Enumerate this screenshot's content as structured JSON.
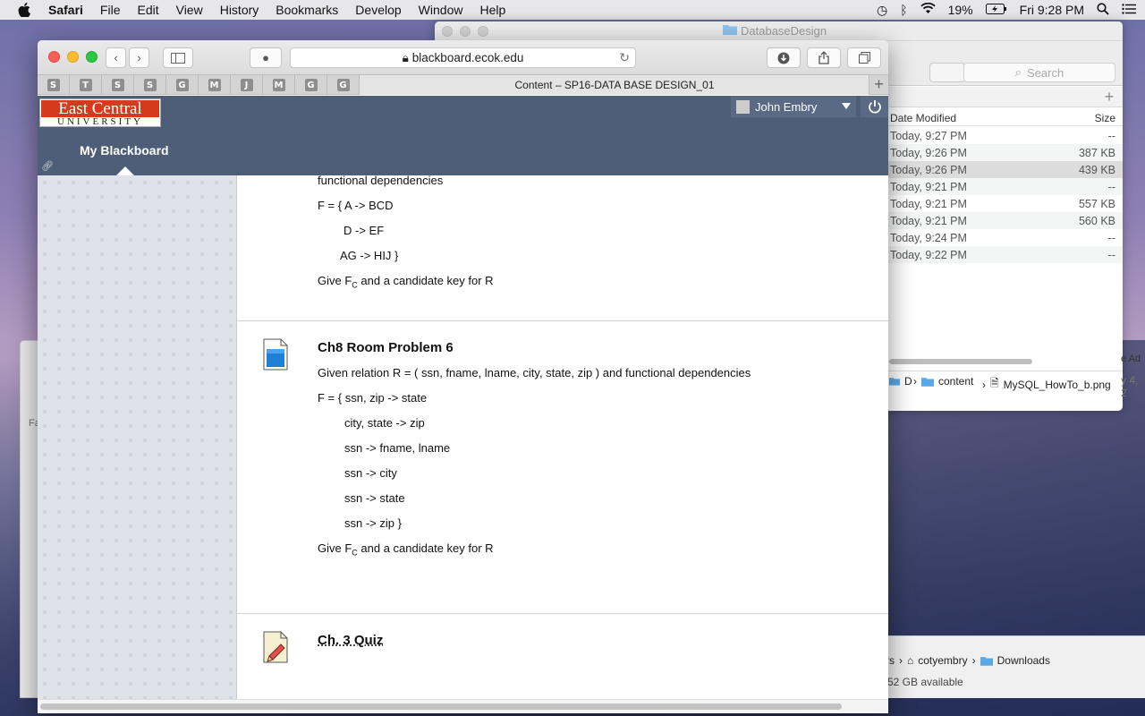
{
  "menubar": {
    "app": "Safari",
    "items": [
      "File",
      "Edit",
      "View",
      "History",
      "Bookmarks",
      "Develop",
      "Window",
      "Help"
    ],
    "battery": "19%",
    "clock": "Fri 9:28 PM"
  },
  "finder": {
    "title": "DatabaseDesign",
    "search_placeholder": "Search",
    "col_date": "Date Modified",
    "col_size": "Size",
    "rows": [
      {
        "date": "Today, 9:27 PM",
        "size": "--"
      },
      {
        "date": "Today, 9:26 PM",
        "size": "387 KB"
      },
      {
        "date": "Today, 9:26 PM",
        "size": "439 KB"
      },
      {
        "date": "Today, 9:21 PM",
        "size": "--"
      },
      {
        "date": "Today, 9:21 PM",
        "size": "557 KB"
      },
      {
        "date": "Today, 9:21 PM",
        "size": "560 KB"
      },
      {
        "date": "Today, 9:24 PM",
        "size": "--"
      },
      {
        "date": "Today, 9:22 PM",
        "size": "--"
      }
    ],
    "path": {
      "p1": "D",
      "p2": "content",
      "p3": "MySQL_HowTo_b.png"
    },
    "side_text_1": "e Ad",
    "side_text_2": "y 4, 2"
  },
  "finder2": {
    "path": {
      "p0": "rs",
      "p1": "cotyembry",
      "p2": "Downloads"
    },
    "available": "52 GB available"
  },
  "leftwin": {
    "label": "Fa"
  },
  "safari": {
    "url": "blackboard.ecok.edu",
    "pinned_tabs": [
      "S",
      "T",
      "S",
      "S",
      "G",
      "M",
      "J",
      "M",
      "G",
      "G"
    ],
    "active_tab_title": "Content – SP16-DATA BASE DESIGN_01"
  },
  "blackboard": {
    "logo_top": "East Central",
    "logo_bottom": "UNIVERSITY",
    "user_name": "John Embry",
    "my_blackboard": "My Blackboard",
    "item1": {
      "line0": "functional dependencies",
      "f1": "F = { A -> BCD",
      "f2": "D -> EF",
      "f3": "AG -> HIJ }",
      "give_pre": "Give F",
      "give_sub": "C",
      "give_post": " and a candidate key for R"
    },
    "item2": {
      "title": "Ch8 Room Problem 6",
      "given": "Given relation R = ( ssn, fname, lname, city, state, zip ) and functional dependencies",
      "f1": "F = { ssn, zip -> state",
      "f2": "city, state -> zip",
      "f3": "ssn -> fname, lname",
      "f4": "ssn -> city",
      "f5": "ssn -> state",
      "f6": "ssn -> zip }",
      "give_pre": "Give F",
      "give_sub": "C",
      "give_post": " and a candidate key for R"
    },
    "item3": {
      "title": "Ch. 3 Quiz"
    }
  },
  "colors": {
    "bb_header": "#4e5d78",
    "logo_red": "#d63a1e"
  }
}
